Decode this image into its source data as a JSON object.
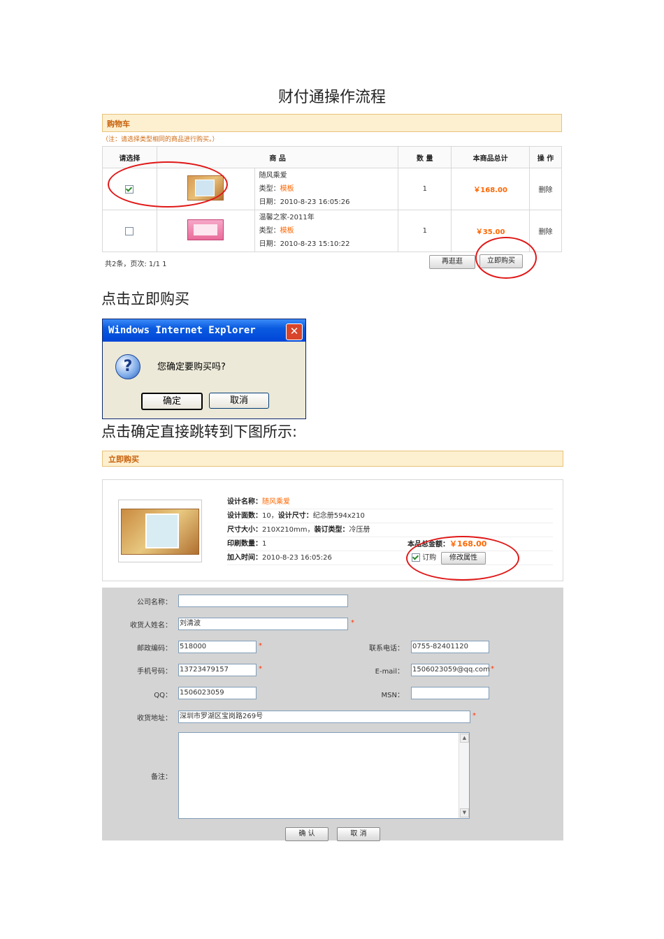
{
  "document": {
    "title": "财付通操作流程",
    "caption_1": "点击立即购买",
    "caption_2": "点击确定直接跳转到下图所示:"
  },
  "cart": {
    "header": "购物车",
    "note": "（注：请选择类型相同的商品进行购买。）",
    "columns": [
      "请选择",
      "商 品",
      "数 量",
      "本商品总计",
      "操 作"
    ],
    "rows": [
      {
        "checked": true,
        "name": "随风乘爱",
        "type_label": "类型：",
        "type_value": "模板",
        "date": "日期：2010-8-23 16:05:26",
        "qty": "1",
        "total": "￥168.00",
        "action": "删除"
      },
      {
        "checked": false,
        "name": "温馨之家-2011年",
        "type_label": "类型：",
        "type_value": "模板",
        "date": "日期：2010-8-23 15:10:22",
        "qty": "1",
        "total": "￥35.00",
        "action": "删除"
      }
    ],
    "pager": "共2条，页次: 1/1  1",
    "continue_button": "再逛逛",
    "buy_button": "立即购买"
  },
  "dialog": {
    "title": "Windows Internet Explorer",
    "close": "✕",
    "icon": "question-icon",
    "message": "您确定要购买吗?",
    "ok": "确定",
    "cancel": "取消"
  },
  "buy_now": {
    "header": "立即购买",
    "design_name_label": "设计名称：",
    "design_name": "随风乘爱",
    "pages_line_label": "设计面数：",
    "pages_line_value": "10，",
    "size_label": "设计尺寸：",
    "size_value": "纪念册594x210",
    "dim_label": "尺寸大小：",
    "dim_value": "210X210mm，",
    "bind_label": "装订类型：",
    "bind_value": "冷压册",
    "print_qty_label": "印刷数量：",
    "print_qty": "1",
    "total_label": "本品总金额：",
    "total": "￥168.00",
    "added_label": "加入时间：",
    "added": "2010-8-23 16:05:26",
    "order_label": "订购",
    "modify_button": "修改属性"
  },
  "form": {
    "company_label": "公司名称：",
    "company_value": "",
    "receiver_label": "收货人姓名：",
    "receiver_value": "刘清波",
    "zip_label": "邮政编码：",
    "zip_value": "518000",
    "phone_label": "联系电话：",
    "phone_value": "0755-82401120",
    "mobile_label": "手机号码：",
    "mobile_value": "13723479157",
    "email_label": "E-mail：",
    "email_value": "1506023059@qq.com",
    "qq_label": "QQ：",
    "qq_value": "1506023059",
    "msn_label": "MSN：",
    "msn_value": "",
    "address_label": "收货地址：",
    "address_value": "深圳市罗湖区宝岗路269号",
    "remark_label": "备注：",
    "remark_value": "",
    "required_mark": "*",
    "confirm_button": "确 认",
    "cancel_button": "取 消"
  },
  "colors": {
    "accent_orange": "#ff6600",
    "highlight_red": "#e01818",
    "header_bg": "#fdf0d0"
  }
}
